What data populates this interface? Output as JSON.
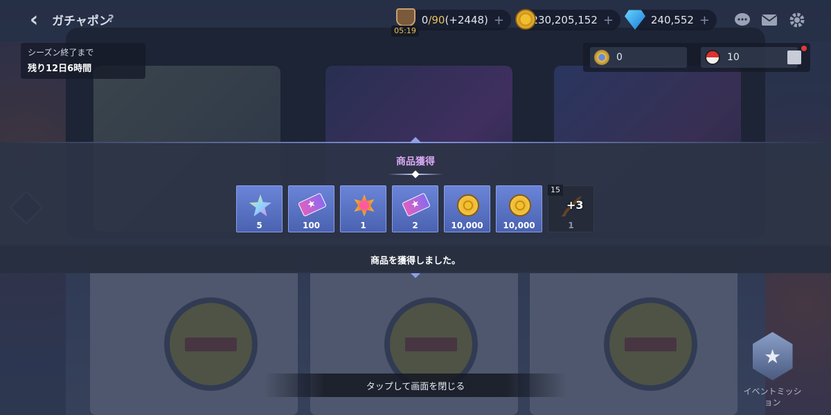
{
  "header": {
    "title": "ガチャポン",
    "help": "?",
    "timer": "05:19"
  },
  "currencies": {
    "stamina": {
      "current": "0",
      "max": "/90",
      "bonus": "(+2448)",
      "plus": "+"
    },
    "coins": {
      "value": "230,205,152",
      "plus": "+"
    },
    "gems": {
      "value": "240,552",
      "plus": "+"
    }
  },
  "season": {
    "label": "シーズン終了まで",
    "remaining": "残り12日6時間"
  },
  "tokens": {
    "coin_token": "0",
    "ball_token": "10"
  },
  "modal": {
    "title": "商品獲得",
    "acquired_message": "商品を獲得しました。",
    "items": [
      {
        "icon": "star-crystal-icon",
        "qty": "5"
      },
      {
        "icon": "ticket-icon",
        "qty": "100"
      },
      {
        "icon": "orange-star-icon",
        "qty": "1"
      },
      {
        "icon": "ticket-icon",
        "qty": "2"
      },
      {
        "icon": "gold-coin-icon",
        "qty": "10,000"
      },
      {
        "icon": "gold-coin-icon",
        "qty": "10,000"
      },
      {
        "icon": "sword-icon",
        "qty": "1",
        "level": "15",
        "enhance": "+3"
      }
    ]
  },
  "close_hint": "タップして画面を閉じる",
  "event_mission": "イベントミッション"
}
